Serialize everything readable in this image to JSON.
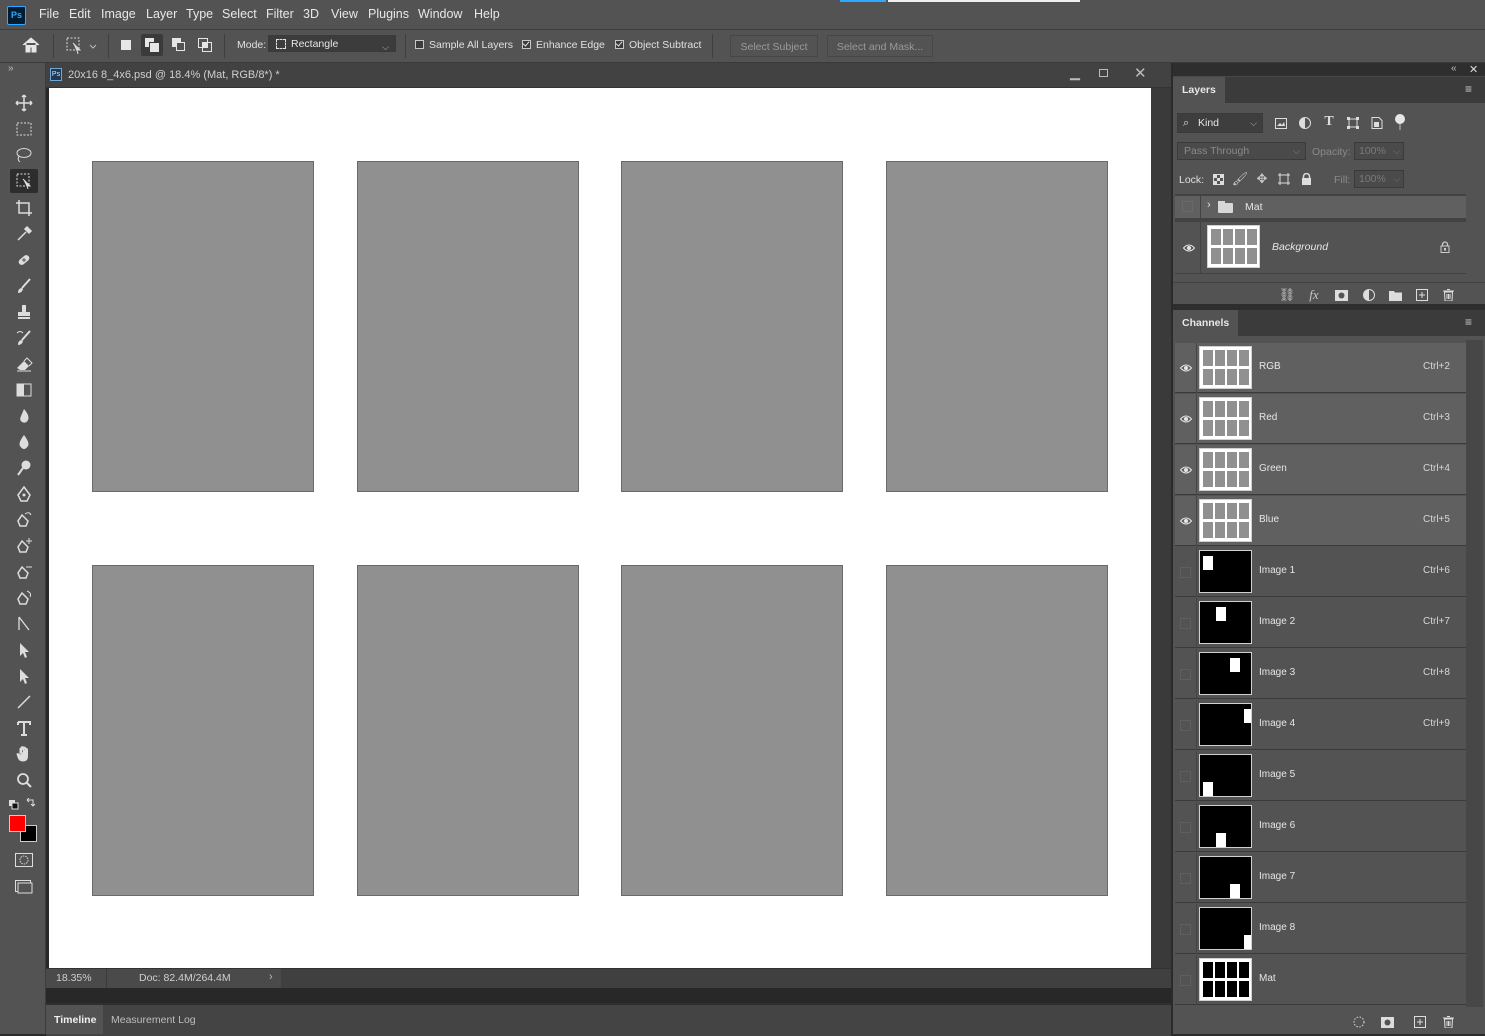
{
  "app": {
    "logo": "Ps"
  },
  "menu": [
    "File",
    "Edit",
    "Image",
    "Layer",
    "Type",
    "Select",
    "Filter",
    "3D",
    "View",
    "Plugins",
    "Window",
    "Help"
  ],
  "options": {
    "mode_label": "Mode:",
    "mode_value": "Rectangle",
    "sample_all_layers": {
      "label": "Sample All Layers",
      "checked": false
    },
    "enhance_edge": {
      "label": "Enhance Edge",
      "checked": true
    },
    "object_subtract": {
      "label": "Object Subtract",
      "checked": true
    },
    "select_subject": "Select Subject",
    "select_and_mask": "Select and Mask..."
  },
  "tools": [
    "move-tool-icon",
    "rectangular-marquee-icon",
    "lasso-icon",
    "object-selection-icon",
    "crop-icon",
    "eyedropper-icon",
    "healing-brush-icon",
    "brush-icon",
    "clone-stamp-icon",
    "history-brush-icon",
    "eraser-icon",
    "gradient-icon",
    "blur-icon",
    "drop-icon",
    "dodge-icon",
    "pen-icon",
    "freeform-pen-icon",
    "add-anchor-icon",
    "delete-anchor-icon",
    "convert-point-icon",
    "anchor-arrow-icon",
    "path-selection-icon",
    "direct-selection-icon",
    "line-icon",
    "type-icon",
    "hand-icon",
    "zoom-icon"
  ],
  "colors": {
    "foreground": "#ff0000",
    "background": "#000000",
    "accent": "#31a8ff"
  },
  "document": {
    "title": "20x16 8_4x6.psd @ 18.4% (Mat, RGB/8*) *",
    "zoom": "18.35%",
    "doc_size": "Doc: 82.4M/264.4M"
  },
  "bottom_tabs": [
    "Timeline",
    "Measurement Log"
  ],
  "layers_panel": {
    "tab": "Layers",
    "kind": "Kind",
    "blend_mode": "Pass Through",
    "opacity_label": "Opacity:",
    "opacity": "100%",
    "lock_label": "Lock:",
    "fill_label": "Fill:",
    "fill": "100%",
    "layers": [
      {
        "name": "Mat",
        "type": "group",
        "visible": false
      },
      {
        "name": "Background",
        "type": "pixel",
        "visible": true,
        "locked": true
      }
    ]
  },
  "channels_panel": {
    "tab": "Channels",
    "channels": [
      {
        "name": "RGB",
        "shortcut": "Ctrl+2",
        "visible": true
      },
      {
        "name": "Red",
        "shortcut": "Ctrl+3",
        "visible": true
      },
      {
        "name": "Green",
        "shortcut": "Ctrl+4",
        "visible": true
      },
      {
        "name": "Blue",
        "shortcut": "Ctrl+5",
        "visible": true
      },
      {
        "name": "Image 1",
        "shortcut": "Ctrl+6",
        "visible": false
      },
      {
        "name": "Image 2",
        "shortcut": "Ctrl+7",
        "visible": false
      },
      {
        "name": "Image 3",
        "shortcut": "Ctrl+8",
        "visible": false
      },
      {
        "name": "Image 4",
        "shortcut": "Ctrl+9",
        "visible": false
      },
      {
        "name": "Image 5",
        "shortcut": "",
        "visible": false
      },
      {
        "name": "Image 6",
        "shortcut": "",
        "visible": false
      },
      {
        "name": "Image 7",
        "shortcut": "",
        "visible": false
      },
      {
        "name": "Image 8",
        "shortcut": "",
        "visible": false
      },
      {
        "name": "Mat",
        "shortcut": "",
        "visible": false
      }
    ]
  }
}
